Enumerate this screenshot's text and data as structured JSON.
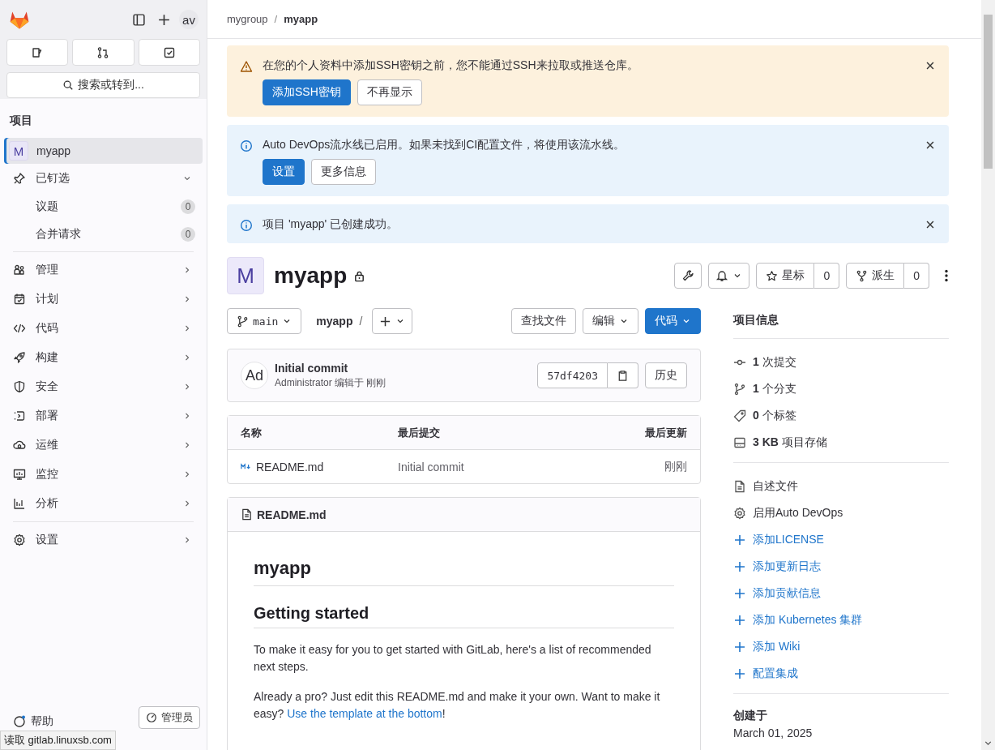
{
  "sidebar": {
    "avatar": "av",
    "search_placeholder": "搜索或转到...",
    "section_title": "项目",
    "project": {
      "initial": "M",
      "name": "myapp",
      "selected": true
    },
    "pinned": {
      "label": "已钉选",
      "expanded": true,
      "children": [
        {
          "label": "议题",
          "count": "0"
        },
        {
          "label": "合并请求",
          "count": "0"
        }
      ]
    },
    "nav": [
      {
        "label": "管理"
      },
      {
        "label": "计划"
      },
      {
        "label": "代码"
      },
      {
        "label": "构建"
      },
      {
        "label": "安全"
      },
      {
        "label": "部署"
      },
      {
        "label": "运维"
      },
      {
        "label": "监控"
      },
      {
        "label": "分析"
      },
      {
        "label": "设置"
      }
    ],
    "footer": {
      "help": "帮助",
      "admin": "管理员"
    }
  },
  "breadcrumb_separator": "/",
  "breadcrumb": [
    {
      "label": "mygroup",
      "current": false
    },
    {
      "label": "myapp",
      "current": true
    }
  ],
  "alerts": [
    {
      "kind": "warning",
      "message": "在您的个人资料中添加SSH密钥之前，您不能通过SSH来拉取或推送仓库。",
      "buttons": [
        {
          "label": "添加SSH密钥",
          "kind": "primary"
        },
        {
          "label": "不再显示",
          "kind": "default"
        }
      ]
    },
    {
      "kind": "info",
      "message": "Auto DevOps流水线已启用。如果未找到CI配置文件，将使用该流水线。",
      "buttons": [
        {
          "label": "设置",
          "kind": "primary"
        },
        {
          "label": "更多信息",
          "kind": "default"
        }
      ]
    },
    {
      "kind": "info",
      "message": "项目 'myapp' 已创建成功。"
    }
  ],
  "project": {
    "initial": "M",
    "name": "myapp",
    "star": {
      "label": "星标",
      "count": "0"
    },
    "fork": {
      "label": "派生",
      "count": "0"
    }
  },
  "repo_bar": {
    "branch": "main",
    "path": "myapp",
    "separator": "/",
    "find_file": "查找文件",
    "edit": "编辑",
    "code": "代码"
  },
  "commit": {
    "avatar": "Ad",
    "title": "Initial commit",
    "byline": "Administrator 编辑于 刚刚",
    "sha": "57df4203",
    "history": "历史"
  },
  "files": {
    "columns": [
      "名称",
      "最后提交",
      "最后更新"
    ],
    "rows": [
      {
        "name": "README.md",
        "commit": "Initial commit",
        "updated": "刚刚"
      }
    ]
  },
  "readme": {
    "filename": "README.md",
    "h1": "myapp",
    "h2": "Getting started",
    "p1": "To make it easy for you to get started with GitLab, here's a list of recommended next steps.",
    "p2_before": "Already a pro? Just edit this README.md and make it your own. Want to make it easy? ",
    "p2_link": "Use the template at the bottom",
    "p2_after": "!"
  },
  "project_info": {
    "title": "项目信息",
    "stats": [
      {
        "text": "**1** 次提交"
      },
      {
        "text": "**1** 个分支"
      },
      {
        "text": "**0** 个标签"
      },
      {
        "text": "**3 KB** 项目存储"
      }
    ],
    "links": [
      {
        "label": "自述文件",
        "kind": "file"
      },
      {
        "label": "启用Auto DevOps",
        "kind": "settings"
      },
      {
        "label": "添加LICENSE",
        "kind": "add"
      },
      {
        "label": "添加更新日志",
        "kind": "add"
      },
      {
        "label": "添加贡献信息",
        "kind": "add"
      },
      {
        "label": "添加 Kubernetes 集群",
        "kind": "add"
      },
      {
        "label": "添加 Wiki",
        "kind": "add"
      },
      {
        "label": "配置集成",
        "kind": "add"
      }
    ],
    "created_title": "创建于",
    "created_date": "March 01, 2025"
  },
  "status_bar": "读取 gitlab.linuxsb.com"
}
